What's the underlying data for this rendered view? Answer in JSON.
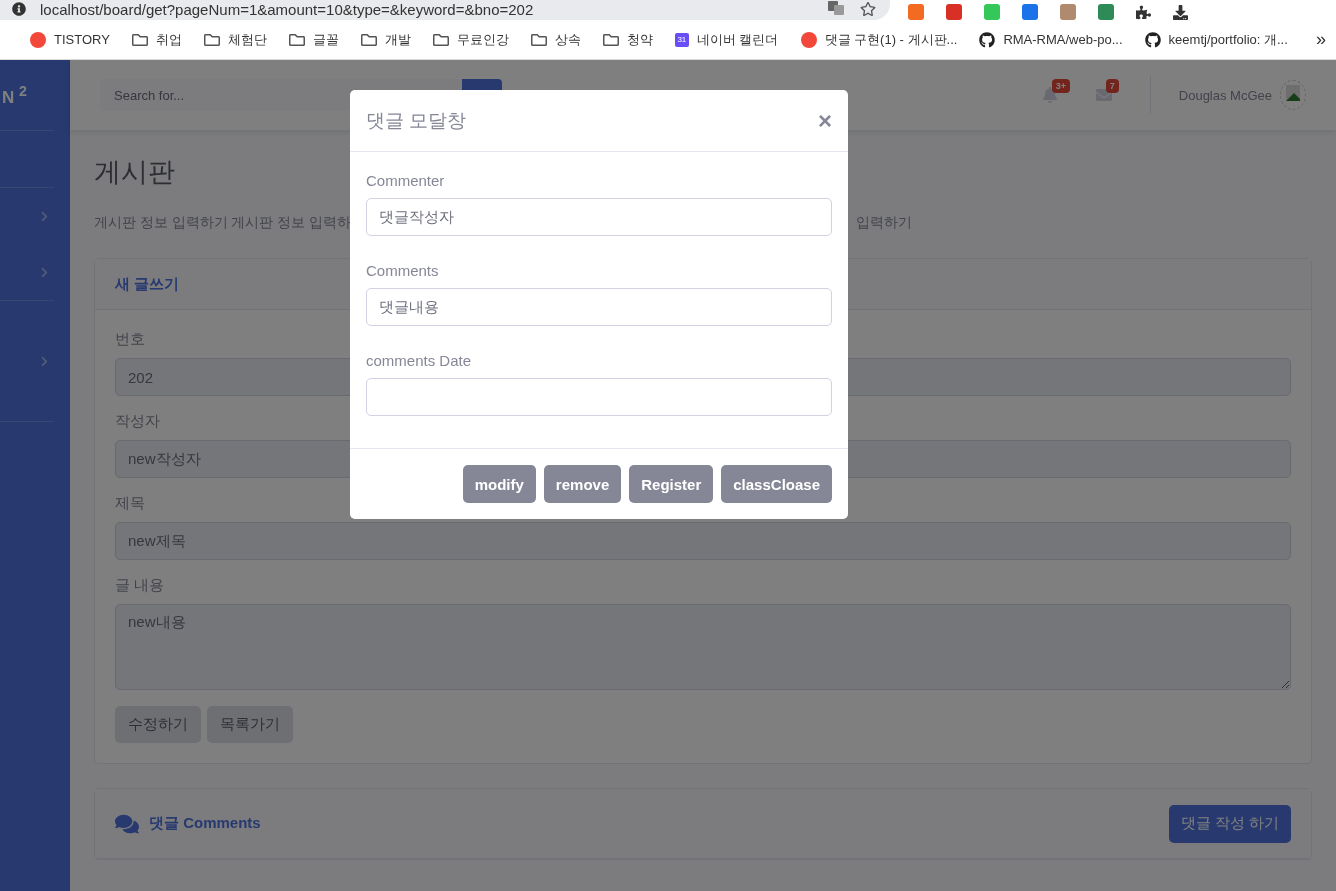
{
  "browser": {
    "url": "localhost/board/get?pageNum=1&amount=10&type=&keyword=&bno=202",
    "bookmarks": [
      {
        "kind": "site",
        "label": "TISTORY"
      },
      {
        "kind": "folder",
        "label": "취업"
      },
      {
        "kind": "folder",
        "label": "체험단"
      },
      {
        "kind": "folder",
        "label": "글꼴"
      },
      {
        "kind": "folder",
        "label": "개발"
      },
      {
        "kind": "folder",
        "label": "무료인강"
      },
      {
        "kind": "folder",
        "label": "상속"
      },
      {
        "kind": "folder",
        "label": "청약"
      },
      {
        "kind": "calendar",
        "label": "네이버 캘린더",
        "icon_text": "31"
      },
      {
        "kind": "site",
        "label": "댓글 구현(1) - 게시판..."
      },
      {
        "kind": "github",
        "label": "RMA-RMA/web-po..."
      },
      {
        "kind": "github",
        "label": "keemtj/portfolio: 개..."
      }
    ],
    "overflow": "»"
  },
  "sidebar": {
    "brand": "N $^{2}$"
  },
  "topbar": {
    "search": {
      "placeholder": "Search for..."
    },
    "alerts_badge": "3+",
    "messages_badge": "7",
    "user": "Douglas McGee"
  },
  "page": {
    "title": "게시판",
    "description_left": "게시판 정보 입력하기 게시판 정보 입력하",
    "description_right": "입력하기"
  },
  "form_card": {
    "header": "새 글쓰기",
    "fields": [
      {
        "kind": "input",
        "label": "번호",
        "value": "202"
      },
      {
        "kind": "input",
        "label": "작성자",
        "value": "new작성자"
      },
      {
        "kind": "input",
        "label": "제목",
        "value": "new제목"
      },
      {
        "kind": "textarea",
        "label": "글 내용",
        "value": "new내용"
      }
    ],
    "buttons": [
      "수정하기",
      "목록가기"
    ]
  },
  "comments_card": {
    "header": "댓글 Comments",
    "button": "댓글 작성 하기"
  },
  "modal": {
    "title": "댓글 모달창",
    "close": "×",
    "fields": [
      {
        "label": "Commenter",
        "value": "댓글작성자"
      },
      {
        "label": "Comments",
        "value": "댓글내용"
      },
      {
        "label": "comments Date"
      }
    ],
    "buttons": [
      "modify",
      "remove",
      "Register",
      "classCloase"
    ]
  }
}
